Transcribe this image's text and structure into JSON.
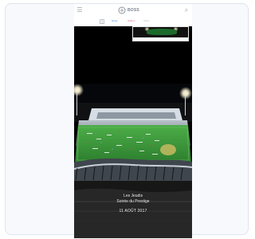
{
  "header": {
    "brand": "BOSS",
    "nav_labels": [
      "News",
      "Gallery",
      "Video"
    ]
  },
  "preview": {
    "label": ""
  },
  "hero": {
    "line1": "Les Jeudis",
    "line2": "Soirée du Prestige",
    "line3": "11 AOÛT 2017"
  },
  "icons": {
    "menu": "menu-icon",
    "search": "search-icon",
    "camera": "camera-icon",
    "logo": "logo-mark"
  },
  "colors": {
    "background": "#ffffff",
    "card": "#f7f9fc",
    "accent_blue": "#4a88d6",
    "accent_pink": "#d17289",
    "field_green": "#2f8a2e"
  }
}
